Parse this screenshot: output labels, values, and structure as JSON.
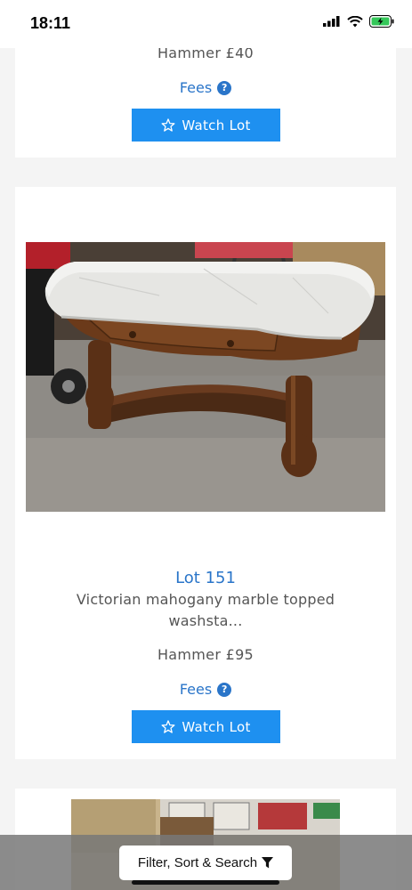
{
  "status": {
    "time": "18:11"
  },
  "lots": [
    {
      "hammer": "Hammer £40",
      "fees_label": "Fees",
      "watch_label": "Watch Lot"
    },
    {
      "title": "Lot 151",
      "description": "Victorian mahogany marble topped washsta...",
      "hammer": "Hammer £95",
      "fees_label": "Fees",
      "watch_label": "Watch Lot"
    }
  ],
  "bottom": {
    "filter_label": "Filter, Sort & Search"
  },
  "colors": {
    "accent": "#1e90f0",
    "link": "#2a75c9"
  }
}
